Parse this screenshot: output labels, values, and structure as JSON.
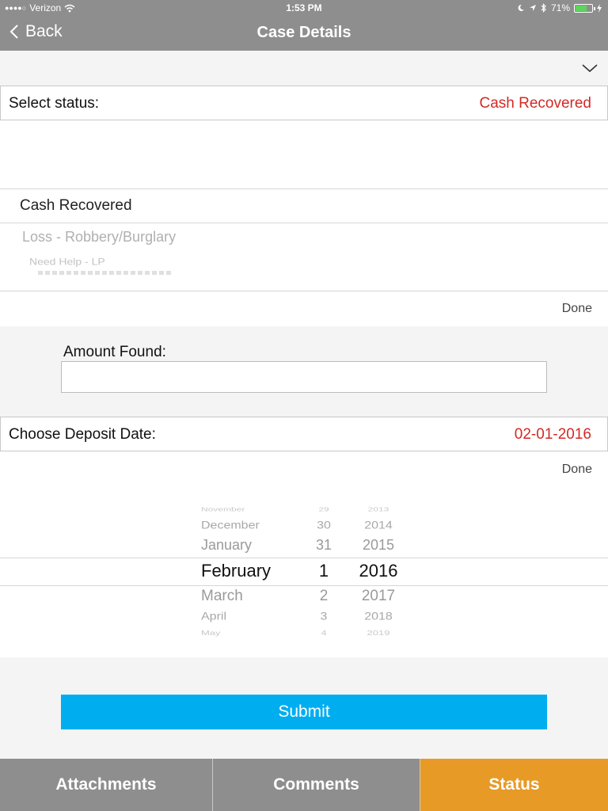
{
  "status_bar": {
    "carrier": "Verizon",
    "signal_dots": "●●●●○",
    "time": "1:53 PM",
    "battery": "71%",
    "battery_level": 0.71
  },
  "nav": {
    "back_label": "Back",
    "title": "Case Details"
  },
  "status_row": {
    "label": "Select status:",
    "value": "Cash Recovered"
  },
  "status_picker": {
    "items": [
      "Cash Recovered",
      "Loss - Robbery/Burglary",
      "Need Help - LP"
    ],
    "done_label": "Done"
  },
  "amount": {
    "label": "Amount Found:",
    "value": ""
  },
  "deposit_row": {
    "label": "Choose Deposit Date:",
    "value": "02-01-2016"
  },
  "date_picker": {
    "done_label": "Done",
    "months": [
      "November",
      "December",
      "January",
      "February",
      "March",
      "April",
      "May"
    ],
    "days": [
      "29",
      "30",
      "31",
      "1",
      "2",
      "3",
      "4"
    ],
    "years": [
      "2013",
      "2014",
      "2015",
      "2016",
      "2017",
      "2018",
      "2019"
    ]
  },
  "submit_label": "Submit",
  "tabs": [
    {
      "label": "Attachments",
      "active": false
    },
    {
      "label": "Comments",
      "active": false
    },
    {
      "label": "Status",
      "active": true
    }
  ],
  "colors": {
    "bar_gray": "#8e8e8e",
    "accent_red": "#d32a26",
    "submit_blue": "#00aef0",
    "active_tab": "#e89a27"
  }
}
